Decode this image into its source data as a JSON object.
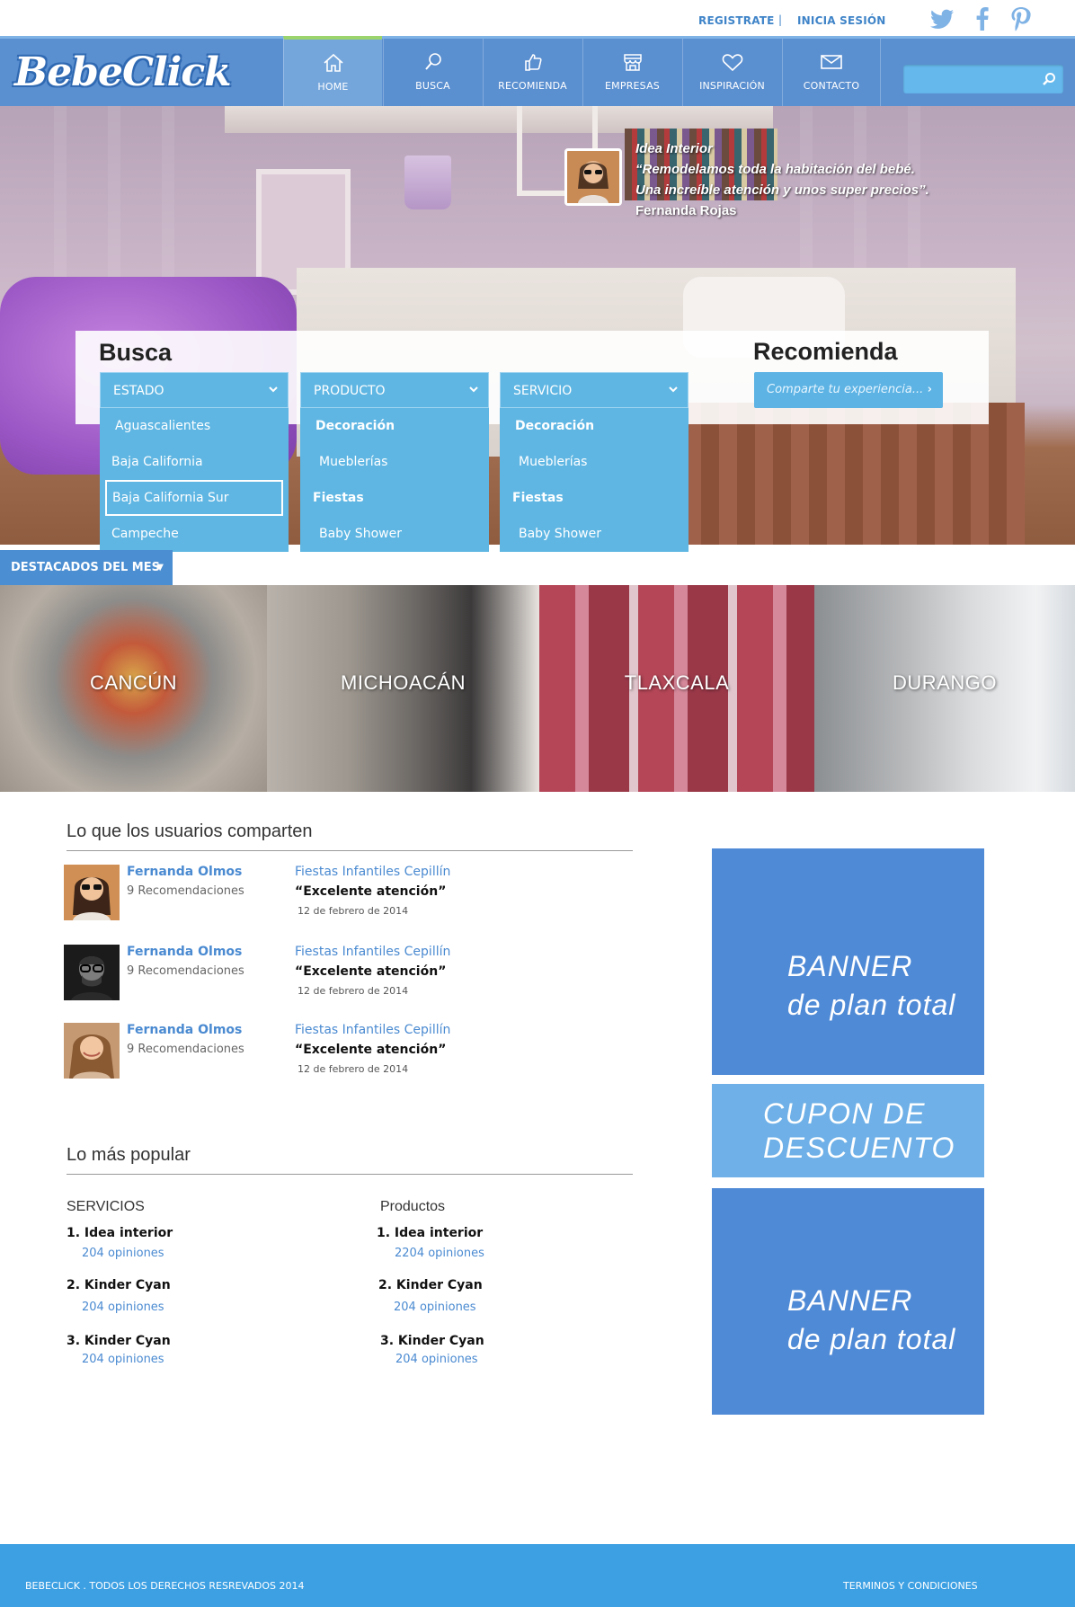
{
  "topbar": {
    "register": "REGISTRATE",
    "separator": "|",
    "login": "INICIA SESIÓN",
    "social": [
      "twitter-icon",
      "facebook-icon",
      "pinterest-icon"
    ]
  },
  "brand": {
    "logo": "BebeClick"
  },
  "nav": {
    "items": [
      {
        "label": "HOME",
        "icon": "home-icon",
        "active": true
      },
      {
        "label": "BUSCA",
        "icon": "search-icon"
      },
      {
        "label": "RECOMIENDA",
        "icon": "thumbs-up-icon"
      },
      {
        "label": "EMPRESAS",
        "icon": "store-icon"
      },
      {
        "label": "INSPIRACIÓN",
        "icon": "heart-icon"
      },
      {
        "label": "CONTACTO",
        "icon": "envelope-icon"
      }
    ],
    "search_placeholder": ""
  },
  "hero": {
    "quote_company": "Idea Interior",
    "quote_line1": "“Remodelamos toda la habitación del bebé.",
    "quote_line2": "Una increíble atención y unos super precios”.",
    "quote_author": "Fernanda Rojas"
  },
  "busca": {
    "title": "Busca",
    "estado": {
      "label": "ESTADO",
      "options": [
        "Aguascalientes",
        "Baja California",
        "Baja California Sur",
        "Campeche"
      ],
      "selected": "Baja California Sur"
    },
    "producto": {
      "label": "PRODUCTO",
      "options": [
        "Decoración",
        "Mueblerías",
        "Fiestas",
        "Baby Shower"
      ]
    },
    "servicio": {
      "label": "SERVICIO",
      "options": [
        "Decoración",
        "Mueblerías",
        "Fiestas",
        "Baby Shower"
      ]
    }
  },
  "recomienda": {
    "title": "Recomienda",
    "button": "Comparte tu experiencia..."
  },
  "destacados": {
    "label": "DESTACADOS DEL MES",
    "tiles": [
      "CANCÚN",
      "MICHOACÁN",
      "TLAXCALA",
      "DURANGO"
    ]
  },
  "comparten": {
    "title": "Lo que los usuarios comparten",
    "items": [
      {
        "user": "Fernanda Olmos",
        "count": "9 Recomendaciones",
        "business": "Fiestas Infantiles Cepillín",
        "quote": "“Excelente atención”",
        "date": "12 de febrero de 2014"
      },
      {
        "user": "Fernanda Olmos",
        "count": "9 Recomendaciones",
        "business": "Fiestas Infantiles Cepillín",
        "quote": "“Excelente atención”",
        "date": "12 de febrero de 2014"
      },
      {
        "user": "Fernanda Olmos",
        "count": "9 Recomendaciones",
        "business": "Fiestas Infantiles Cepillín",
        "quote": "“Excelente atención”",
        "date": "12 de febrero de 2014"
      }
    ]
  },
  "popular": {
    "title": "Lo más popular",
    "servicios": {
      "heading": "SERVICIOS",
      "items": [
        {
          "name": "1. Idea interior",
          "opinions": "204 opiniones"
        },
        {
          "name": "2. Kinder Cyan",
          "opinions": "204 opiniones"
        },
        {
          "name": "3. Kinder Cyan",
          "opinions": "204 opiniones"
        }
      ]
    },
    "productos": {
      "heading": "Productos",
      "items": [
        {
          "name": "1. Idea interior",
          "opinions": "2204 opiniones"
        },
        {
          "name": "2. Kinder Cyan",
          "opinions": "204 opiniones"
        },
        {
          "name": "3. Kinder Cyan",
          "opinions": "204 opiniones"
        }
      ]
    }
  },
  "ads": {
    "banner1_line1": "BANNER",
    "banner1_line2": "de plan total",
    "cupon_line1": "CUPON DE",
    "cupon_line2": "DESCUENTO",
    "banner2_line1": "BANNER",
    "banner2_line2": "de plan total"
  },
  "footer": {
    "copyright": "BEBECLICK . TODOS LOS DERECHOS RESREVADOS 2014",
    "terms": "TERMINOS Y CONDICIONES"
  },
  "colors": {
    "nav": "#5a8fd0",
    "accent": "#5fb6e3",
    "link": "#4a8ad1",
    "footer": "#3da0e3",
    "banner": "#4f8ad6"
  }
}
